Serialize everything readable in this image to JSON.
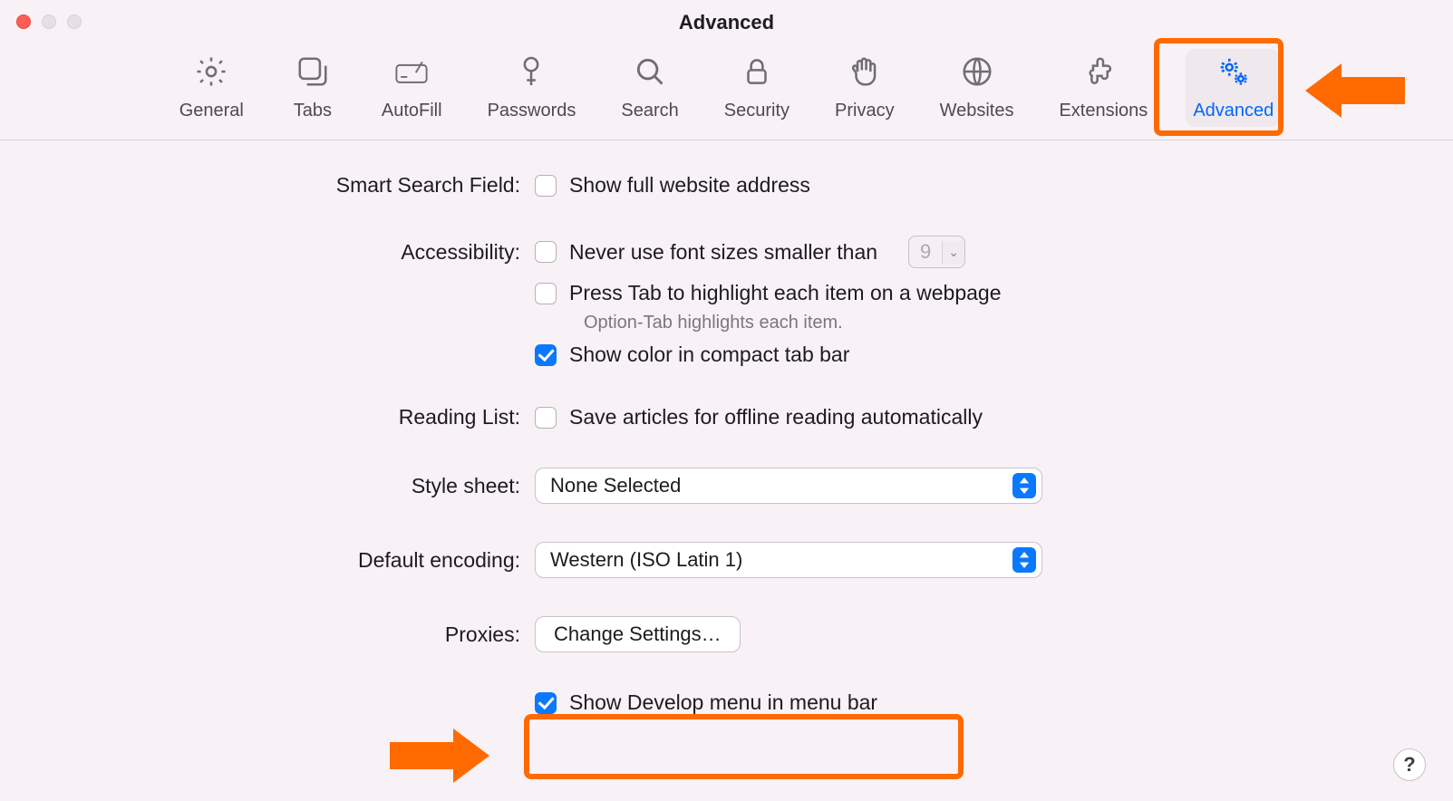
{
  "window": {
    "title": "Advanced"
  },
  "tabs": {
    "general": "General",
    "tabs": "Tabs",
    "autofill": "AutoFill",
    "passwords": "Passwords",
    "search": "Search",
    "security": "Security",
    "privacy": "Privacy",
    "websites": "Websites",
    "extensions": "Extensions",
    "advanced": "Advanced"
  },
  "sections": {
    "smart_search": {
      "label": "Smart Search Field:",
      "show_full_address": "Show full website address"
    },
    "accessibility": {
      "label": "Accessibility:",
      "never_font_size": "Never use font sizes smaller than",
      "font_size_value": "9",
      "press_tab": "Press Tab to highlight each item on a webpage",
      "option_tab_hint": "Option-Tab highlights each item.",
      "show_color": "Show color in compact tab bar"
    },
    "reading_list": {
      "label": "Reading List:",
      "save_offline": "Save articles for offline reading automatically"
    },
    "style_sheet": {
      "label": "Style sheet:",
      "selected": "None Selected"
    },
    "default_encoding": {
      "label": "Default encoding:",
      "selected": "Western (ISO Latin 1)"
    },
    "proxies": {
      "label": "Proxies:",
      "button": "Change Settings…"
    },
    "develop": {
      "label": "Show Develop menu in menu bar"
    }
  },
  "help_symbol": "?"
}
